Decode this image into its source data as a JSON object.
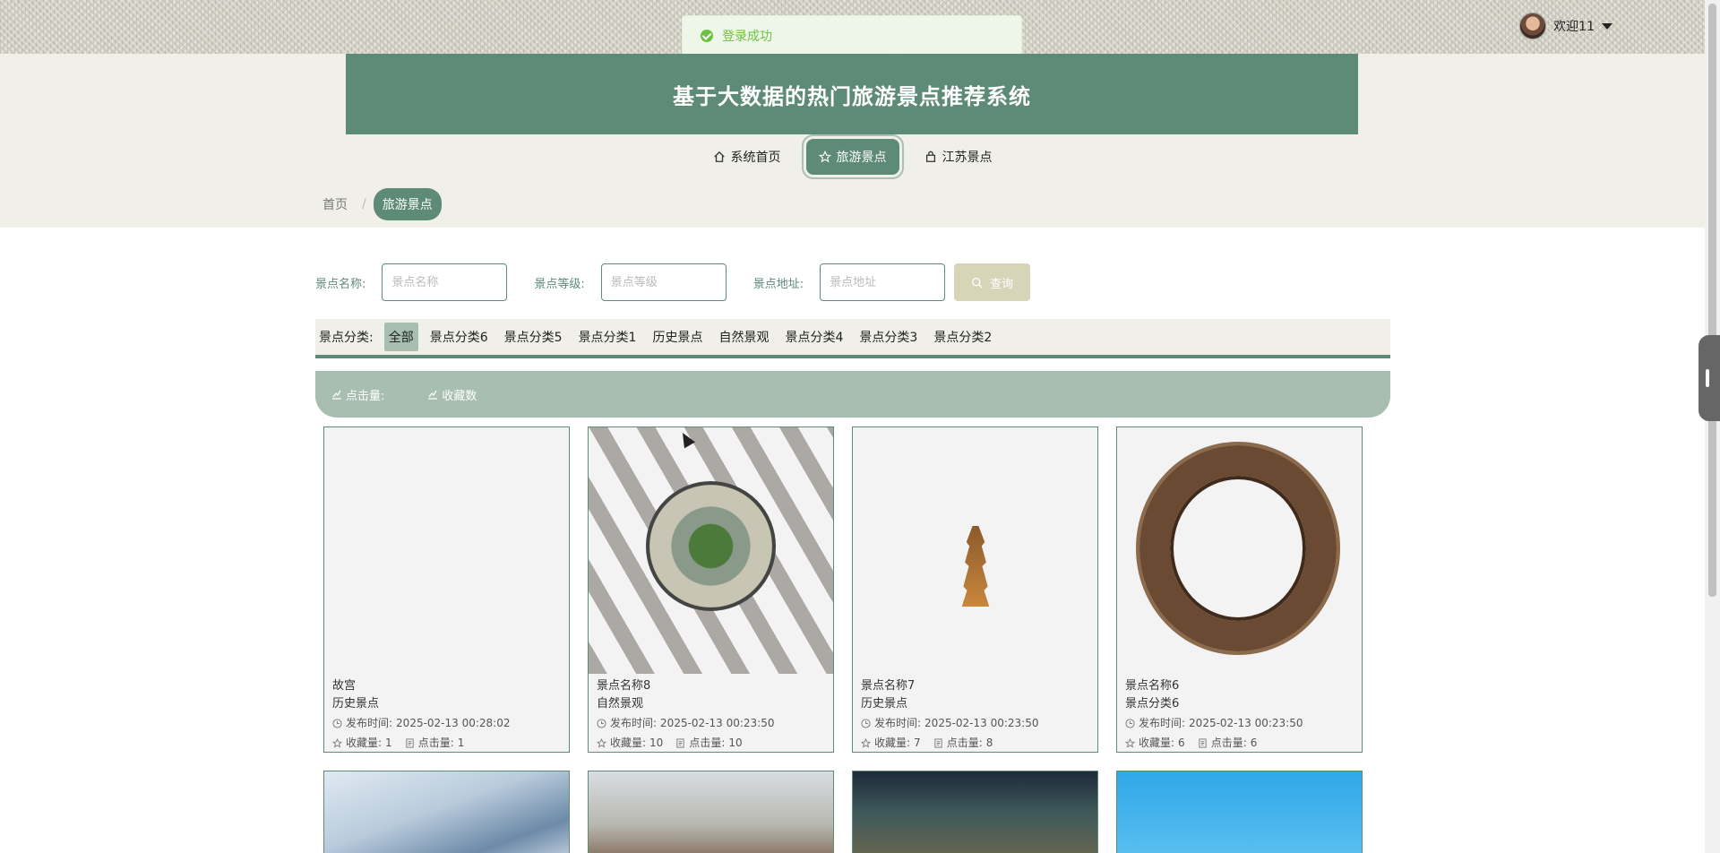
{
  "toast": {
    "message": "登录成功"
  },
  "header": {
    "user_greeting": "欢迎11",
    "title": "基于大数据的热门旅游景点推荐系统"
  },
  "nav": {
    "items": [
      {
        "label": "系统首页",
        "icon": "home-icon"
      },
      {
        "label": "旅游景点",
        "icon": "star-icon",
        "active": true
      },
      {
        "label": "江苏景点",
        "icon": "bag-icon"
      }
    ]
  },
  "breadcrumb": {
    "home": "首页",
    "separator": "/",
    "current": "旅游景点"
  },
  "search": {
    "name_label": "景点名称:",
    "name_placeholder": "景点名称",
    "level_label": "景点等级:",
    "level_placeholder": "景点等级",
    "address_label": "景点地址:",
    "address_placeholder": "景点地址",
    "button_label": "查询"
  },
  "categories": {
    "label": "景点分类:",
    "items": [
      "全部",
      "景点分类6",
      "景点分类5",
      "景点分类1",
      "历史景点",
      "自然景观",
      "景点分类4",
      "景点分类3",
      "景点分类2"
    ],
    "active": "全部"
  },
  "sort": {
    "clicks": "点击量:",
    "favorites": "收藏数"
  },
  "cards": [
    {
      "name": "故宫",
      "category": "历史景点",
      "time_label": "发布时间:",
      "time": "2025-02-13 00:28:02",
      "fav_label": "收藏量:",
      "fav": "1",
      "click_label": "点击量:",
      "clicks": "1"
    },
    {
      "name": "景点名称8",
      "category": "自然景观",
      "time_label": "发布时间:",
      "time": "2025-02-13 00:23:50",
      "fav_label": "收藏量:",
      "fav": "10",
      "click_label": "点击量:",
      "clicks": "10"
    },
    {
      "name": "景点名称7",
      "category": "历史景点",
      "time_label": "发布时间:",
      "time": "2025-02-13 00:23:50",
      "fav_label": "收藏量:",
      "fav": "7",
      "click_label": "点击量:",
      "clicks": "8"
    },
    {
      "name": "景点名称6",
      "category": "景点分类6",
      "time_label": "发布时间:",
      "time": "2025-02-13 00:23:50",
      "fav_label": "收藏量:",
      "fav": "6",
      "click_label": "点击量:",
      "clicks": "6"
    }
  ],
  "colors": {
    "primary": "#5e8b78",
    "soft": "#a7beb1",
    "band": "#f0f0e8",
    "success": "#67c23a"
  }
}
